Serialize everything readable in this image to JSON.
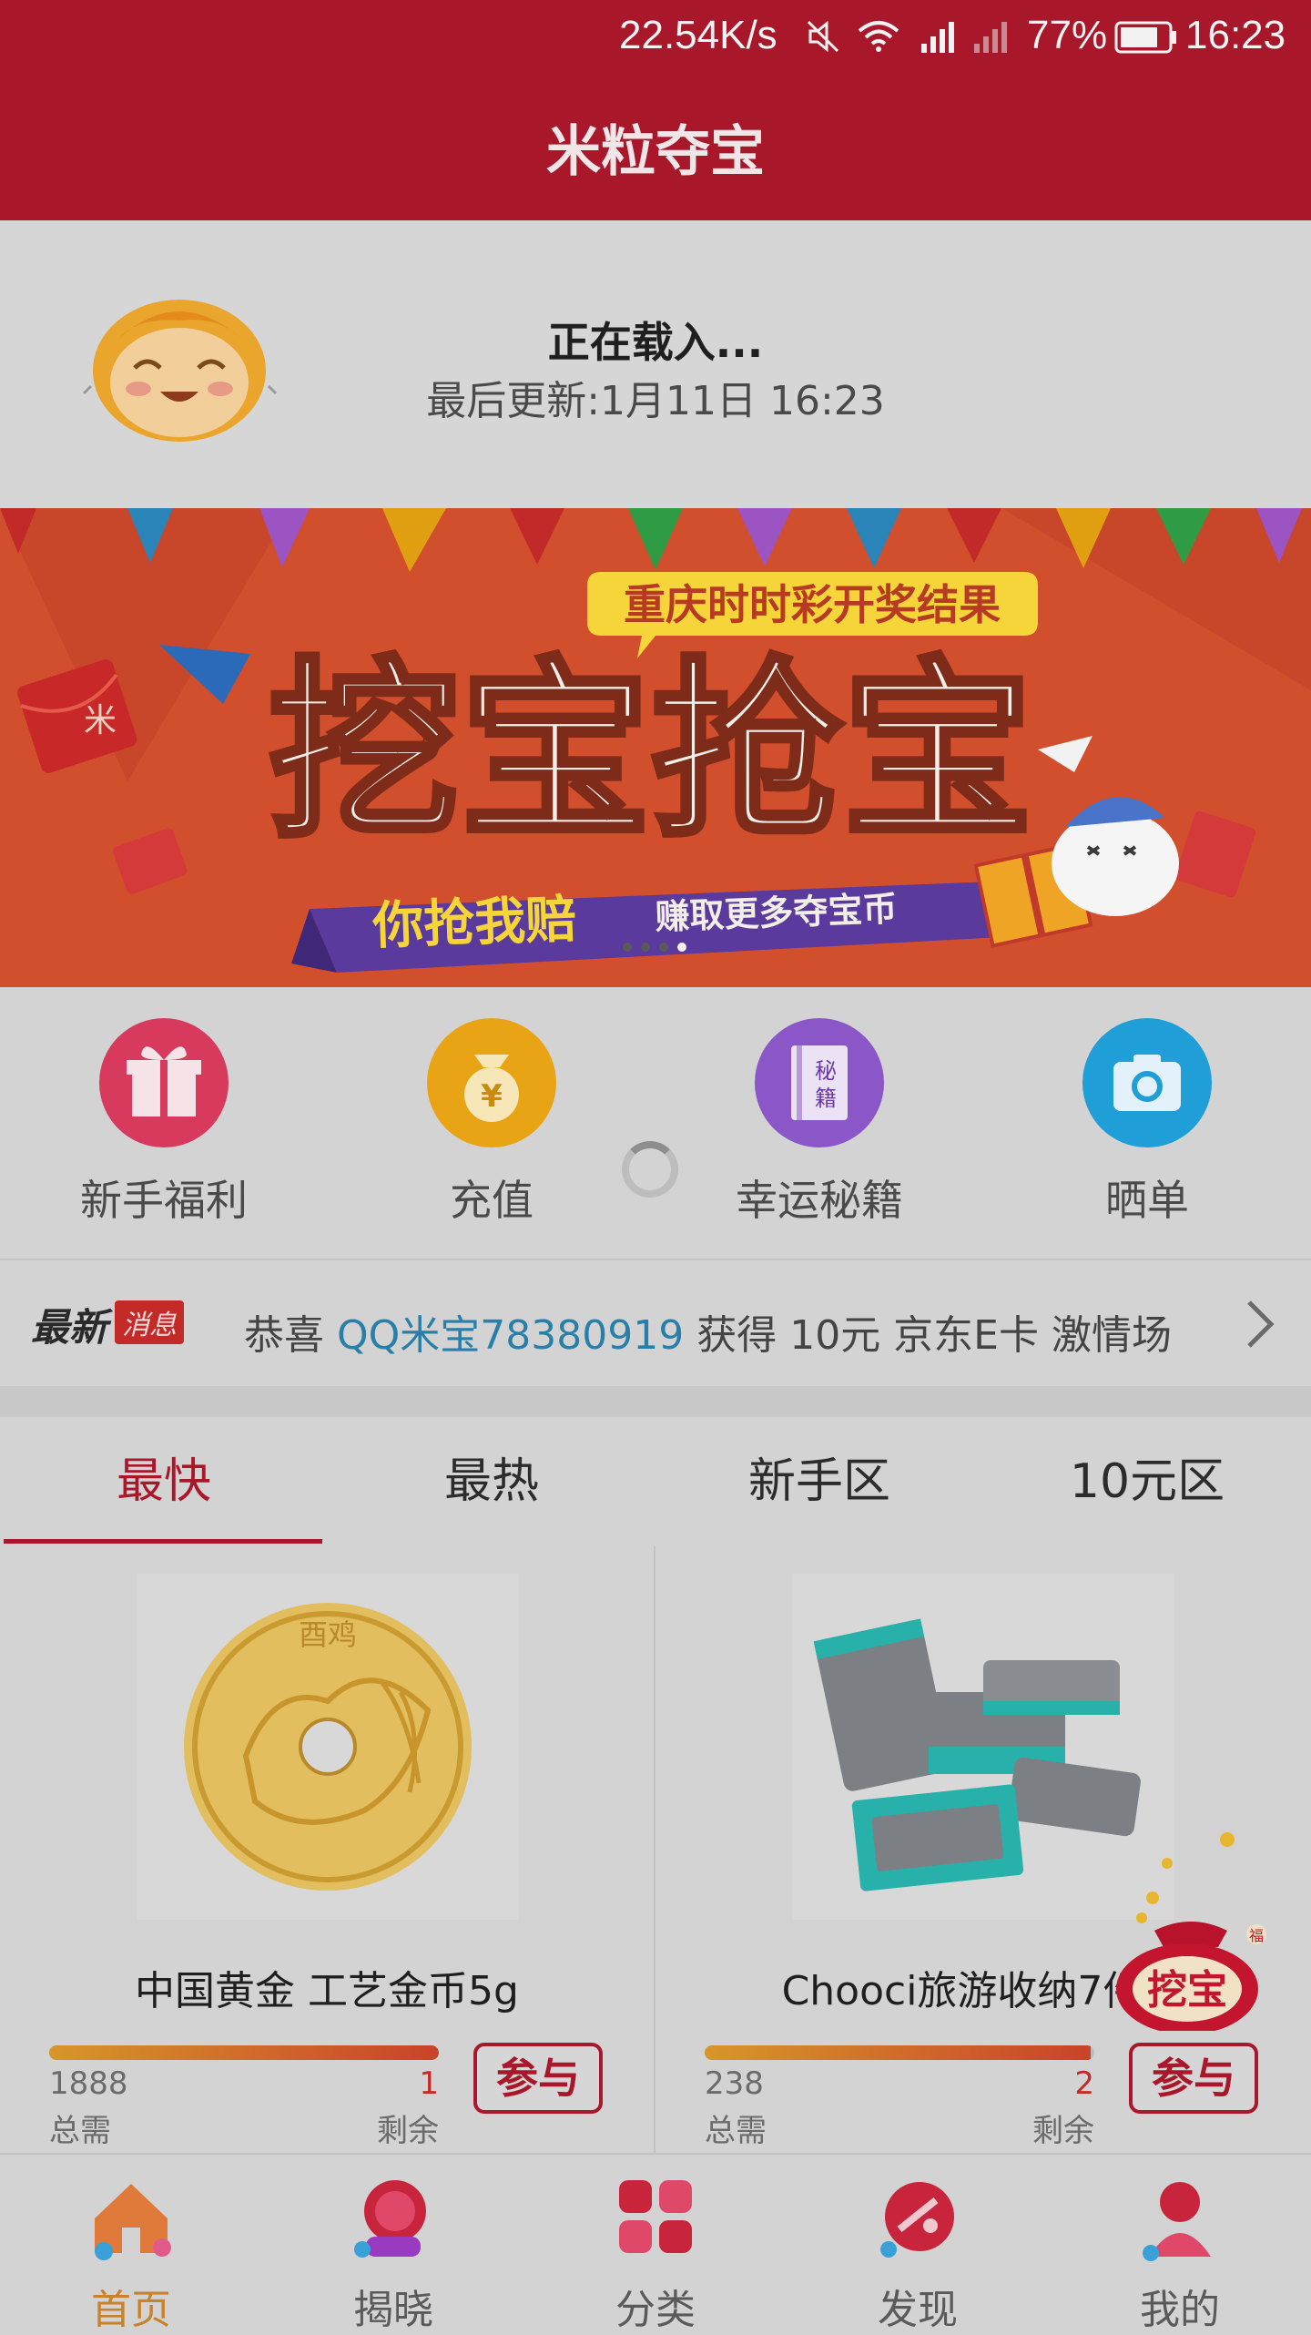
{
  "status_bar": {
    "speed": "22.54K/s",
    "battery": "77%",
    "time": "16:23"
  },
  "header": {
    "title": "米粒夺宝"
  },
  "refresh": {
    "status": "正在载入...",
    "last_update": "最后更新:1月11日 16:23"
  },
  "banner": {
    "tagline": "重庆时时彩开奖结果",
    "headline": "挖宝抢宝",
    "slogan_bold": "你抢我赔",
    "slogan": "赚取更多夺宝币",
    "envelope_char": "米",
    "page_count": 4,
    "active_page": 1
  },
  "quick_actions": [
    {
      "label": "新手福利",
      "icon": "gift-icon",
      "color": "#d83a5e"
    },
    {
      "label": "充值",
      "icon": "money-bag-icon",
      "color": "#e8a414",
      "glyph": "¥"
    },
    {
      "label": "幸运秘籍",
      "icon": "book-icon",
      "color": "#8a56c8",
      "glyph1": "秘",
      "glyph2": "籍"
    },
    {
      "label": "晒单",
      "icon": "camera-icon",
      "color": "#1f9ed8"
    }
  ],
  "news": {
    "label_bold": "最新",
    "label_badge": "消息",
    "prefix": "恭喜",
    "user": "QQ米宝78380919",
    "suffix": "获得 10元 京东E卡 激情场"
  },
  "tabs": [
    {
      "label": "最快",
      "active": true
    },
    {
      "label": "最热",
      "active": false
    },
    {
      "label": "新手区",
      "active": false
    },
    {
      "label": "10元区",
      "active": false
    }
  ],
  "products": [
    {
      "name": "中国黄金 工艺金币5g",
      "total": "1888",
      "total_label": "总需",
      "remaining": "1",
      "remaining_label": "剩余",
      "join_label": "参与",
      "progress": 0.9995,
      "coin_text": "酉鸡"
    },
    {
      "name": "Chooci旅游收纳7件套",
      "total": "238",
      "total_label": "总需",
      "remaining": "2",
      "remaining_label": "剩余",
      "join_label": "参与",
      "progress": 0.99
    }
  ],
  "float_button": {
    "label": "挖宝",
    "badge": "福"
  },
  "bottom_nav": [
    {
      "label": "首页",
      "icon": "home-icon",
      "active": true
    },
    {
      "label": "揭晓",
      "icon": "reveal-icon",
      "active": false
    },
    {
      "label": "分类",
      "icon": "category-icon",
      "active": false
    },
    {
      "label": "发现",
      "icon": "discover-icon",
      "active": false
    },
    {
      "label": "我的",
      "icon": "profile-icon",
      "active": false
    }
  ]
}
